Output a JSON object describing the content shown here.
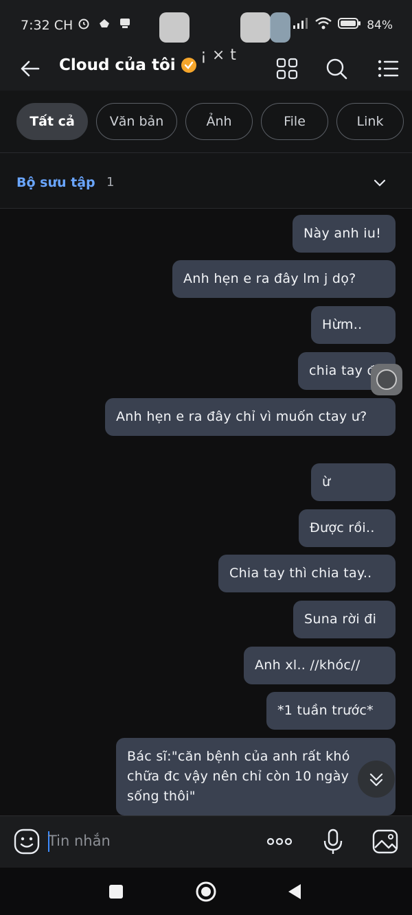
{
  "status_bar": {
    "time": "7:32",
    "period": "CH",
    "battery": "84%"
  },
  "header": {
    "title": "Cloud của tôi",
    "deco_text": "¡×t"
  },
  "filters": [
    "Tất cả",
    "Văn bản",
    "Ảnh",
    "File",
    "Link"
  ],
  "collection": {
    "label": "Bộ sưu tập",
    "count": "1"
  },
  "messages": [
    "Này anh iu!",
    "Anh hẹn e ra đây lm j dọ?",
    "Hừm..",
    "chia tay đi",
    "Anh hẹn e ra đây chỉ vì muốn ctay ư?",
    "ừ",
    "Được rồi..",
    "Chia tay thì chia tay..",
    "Suna rời đi",
    "Anh xl.. //khóc//",
    "*1 tuần trước*",
    "Bác sĩ:\"căn bệnh của anh rất khó chữa đc vậy nên chỉ còn 10 ngày sống thôi\""
  ],
  "composer": {
    "placeholder": "Tin nhắn"
  },
  "colors": {
    "bubble": "#3a4150",
    "background": "#0f0f10",
    "accent": "#6aa6ff",
    "verified": "#f6a62b"
  }
}
